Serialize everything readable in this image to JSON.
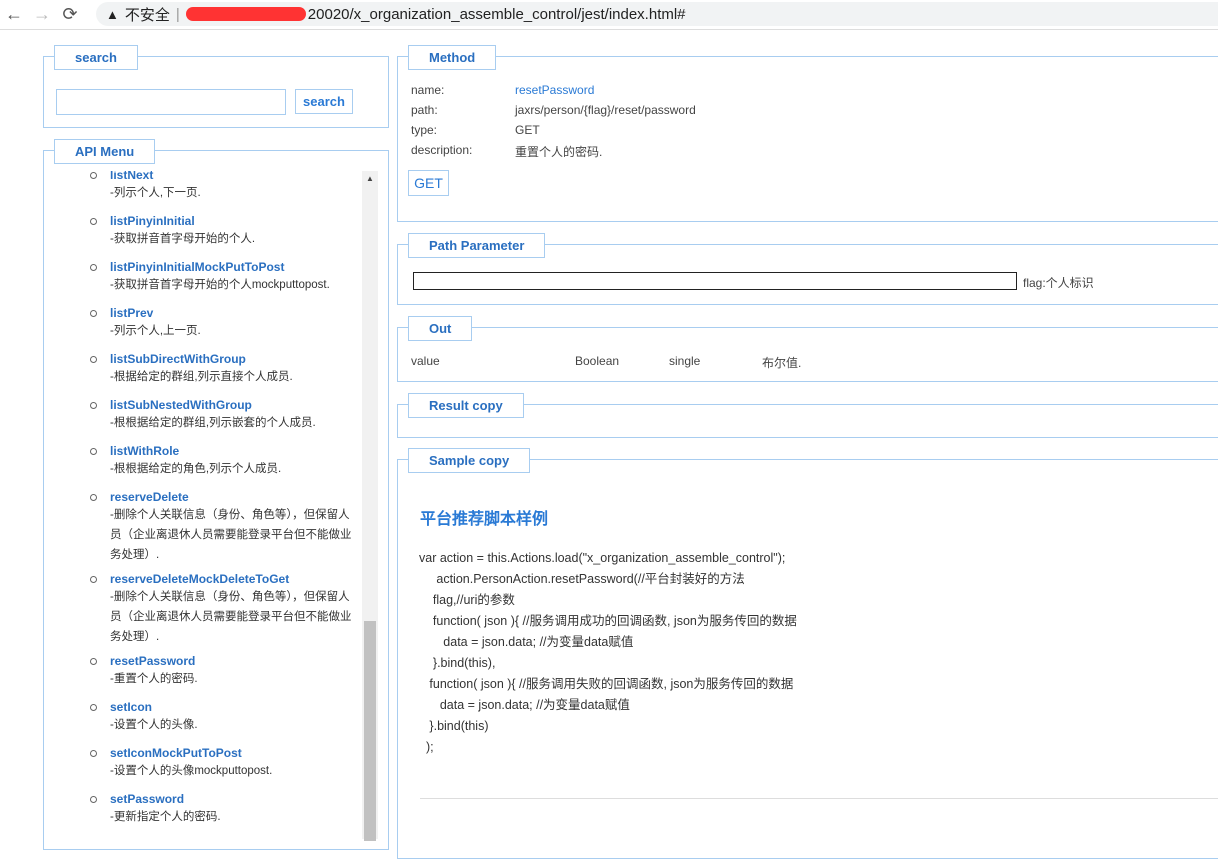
{
  "browser": {
    "back": "←",
    "forward": "→",
    "reload": "⟳",
    "security": "不安全",
    "url": "20020/x_organization_assemble_control/jest/index.html#"
  },
  "search": {
    "legend": "search",
    "input_value": "",
    "button": "search"
  },
  "menu": {
    "legend": "API Menu",
    "items": [
      {
        "name": "listNext",
        "desc": "-列示个人,下一页."
      },
      {
        "name": "listPinyinInitial",
        "desc": "-获取拼音首字母开始的个人."
      },
      {
        "name": "listPinyinInitialMockPutToPost",
        "desc": "-获取拼音首字母开始的个人mockputtopost."
      },
      {
        "name": "listPrev",
        "desc": "-列示个人,上一页."
      },
      {
        "name": "listSubDirectWithGroup",
        "desc": "-根据给定的群组,列示直接个人成员."
      },
      {
        "name": "listSubNestedWithGroup",
        "desc": "-根根据给定的群组,列示嵌套的个人成员."
      },
      {
        "name": "listWithRole",
        "desc": "-根根据给定的角色,列示个人成员."
      },
      {
        "name": "reserveDelete",
        "desc": "-删除个人关联信息（身份、角色等），但保留人员（企业离退休人员需要能登录平台但不能做业务处理）."
      },
      {
        "name": "reserveDeleteMockDeleteToGet",
        "desc": "-删除个人关联信息（身份、角色等），但保留人员（企业离退休人员需要能登录平台但不能做业务处理）."
      },
      {
        "name": "resetPassword",
        "desc": "-重置个人的密码."
      },
      {
        "name": "setIcon",
        "desc": "-设置个人的头像."
      },
      {
        "name": "setIconMockPutToPost",
        "desc": "-设置个人的头像mockputtopost."
      },
      {
        "name": "setPassword",
        "desc": "-更新指定个人的密码."
      }
    ]
  },
  "method": {
    "legend": "Method",
    "name_label": "name:",
    "name": "resetPassword",
    "path_label": "path:",
    "path": "jaxrs/person/{flag}/reset/password",
    "type_label": "type:",
    "type": "GET",
    "desc_label": "description:",
    "desc": "重置个人的密码.",
    "button": "GET"
  },
  "path_param": {
    "legend": "Path Parameter",
    "value": "",
    "label": "flag:个人标识"
  },
  "out": {
    "legend": "Out",
    "row": [
      "value",
      "Boolean",
      "single",
      "布尔值."
    ]
  },
  "result": {
    "legend": "Result copy"
  },
  "sample": {
    "legend": "Sample copy",
    "title": "平台推荐脚本样例",
    "lines": [
      "var action = this.Actions.load(\"x_organization_assemble_control\");",
      "     action.PersonAction.resetPassword(//平台封装好的方法",
      "    flag,//uri的参数",
      "    function( json ){ //服务调用成功的回调函数, json为服务传回的数据",
      "       data = json.data; //为变量data赋值",
      "    }.bind(this),",
      "   function( json ){ //服务调用失败的回调函数, json为服务传回的数据",
      "      data = json.data; //为变量data赋值",
      "   }.bind(this)",
      "  );"
    ]
  }
}
